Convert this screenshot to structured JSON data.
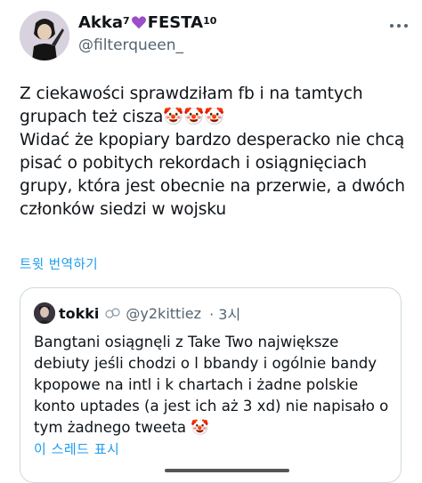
{
  "author": {
    "display_name_prefix": "Akka",
    "display_name_sup1": "7",
    "display_name_suffix": "FESTA",
    "display_name_sup2": "10",
    "handle": "@filterqueen_"
  },
  "tweet": {
    "text": "Z ciekawości sprawdziłam fb i na tamtych grupach też cisza🤡🤡🤡\nWidać że kpopiary bardzo desperacko nie chcą pisać o pobitych rekordach i osiągnięciach grupy, która jest obecnie na przerwie, a dwóch członków siedzi w wojsku",
    "translate_label": "트윗 번역하기"
  },
  "quoted": {
    "name": "tokki",
    "handle": "@y2kittiez",
    "time": "· 3시",
    "text": "Bangtani osiągnęli z Take Two największe debiuty jeśli chodzi o l bbandy i ogólnie bandy kpopowe na intl i k chartach i żadne polskie konto uptades (a jest ich aż 3 xd) nie napisało o tym żadnego tweeta 🤡",
    "show_thread_label": "이 스레드 표시"
  },
  "colors": {
    "link": "#1d9bf0",
    "secondary_text": "#536471",
    "heart": "#9b4dca",
    "border": "#cfd9de"
  },
  "icons": {
    "more": "more-horizontal-icon",
    "heart": "purple-heart-icon",
    "clown": "clown-face-emoji"
  }
}
